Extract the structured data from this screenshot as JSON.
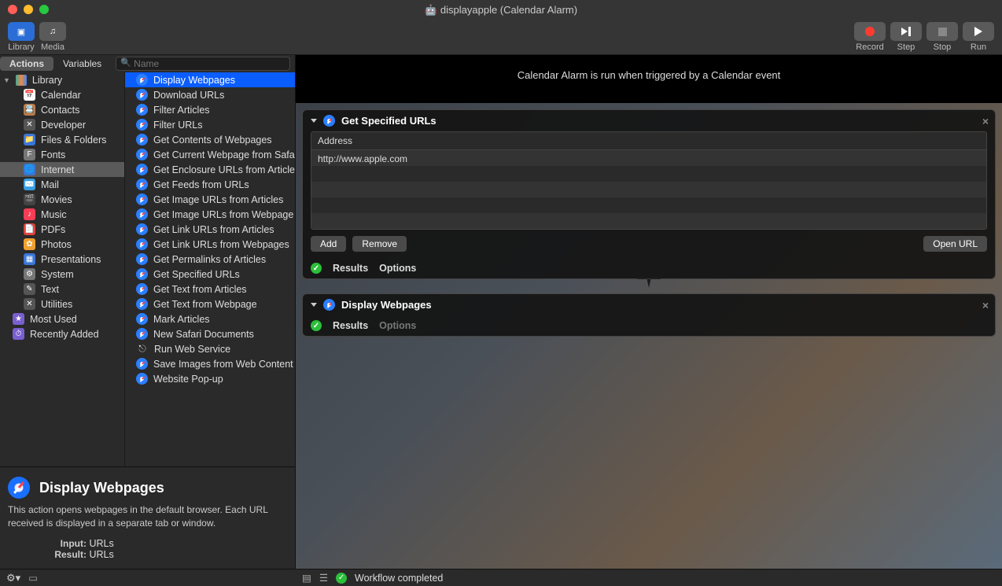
{
  "window": {
    "title": "displayapple (Calendar Alarm)"
  },
  "toolbar": {
    "library": "Library",
    "media": "Media",
    "record": "Record",
    "step": "Step",
    "stop": "Stop",
    "run": "Run"
  },
  "tabs": {
    "actions": "Actions",
    "variables": "Variables"
  },
  "search": {
    "placeholder": "Name"
  },
  "library": {
    "header": "Library",
    "items": [
      {
        "label": "Calendar",
        "icon": "📅",
        "bg": "#fff"
      },
      {
        "label": "Contacts",
        "icon": "📇",
        "bg": "#b97d4b"
      },
      {
        "label": "Developer",
        "icon": "✕",
        "bg": "#555"
      },
      {
        "label": "Files & Folders",
        "icon": "📁",
        "bg": "#3a76d8"
      },
      {
        "label": "Fonts",
        "icon": "F",
        "bg": "#777"
      },
      {
        "label": "Internet",
        "icon": "🌐",
        "bg": "#3a76d8",
        "selected": true
      },
      {
        "label": "Mail",
        "icon": "✉️",
        "bg": "#3a9de0"
      },
      {
        "label": "Movies",
        "icon": "🎬",
        "bg": "#444"
      },
      {
        "label": "Music",
        "icon": "♪",
        "bg": "#fa3c55"
      },
      {
        "label": "PDFs",
        "icon": "📄",
        "bg": "#e0443a"
      },
      {
        "label": "Photos",
        "icon": "✿",
        "bg": "#f0a030"
      },
      {
        "label": "Presentations",
        "icon": "▦",
        "bg": "#3a76d8"
      },
      {
        "label": "System",
        "icon": "⚙",
        "bg": "#777"
      },
      {
        "label": "Text",
        "icon": "✎",
        "bg": "#555"
      },
      {
        "label": "Utilities",
        "icon": "✕",
        "bg": "#555"
      }
    ],
    "footer": [
      {
        "label": "Most Used",
        "icon": "★",
        "bg": "#7a5fd0"
      },
      {
        "label": "Recently Added",
        "icon": "⏱",
        "bg": "#7a5fd0"
      }
    ]
  },
  "actions": [
    {
      "label": "Display Webpages",
      "selected": true
    },
    {
      "label": "Download URLs"
    },
    {
      "label": "Filter Articles"
    },
    {
      "label": "Filter URLs"
    },
    {
      "label": "Get Contents of Webpages"
    },
    {
      "label": "Get Current Webpage from Safari"
    },
    {
      "label": "Get Enclosure URLs from Articles"
    },
    {
      "label": "Get Feeds from URLs"
    },
    {
      "label": "Get Image URLs from Articles"
    },
    {
      "label": "Get Image URLs from Webpage"
    },
    {
      "label": "Get Link URLs from Articles"
    },
    {
      "label": "Get Link URLs from Webpages"
    },
    {
      "label": "Get Permalinks of Articles"
    },
    {
      "label": "Get Specified URLs"
    },
    {
      "label": "Get Text from Articles"
    },
    {
      "label": "Get Text from Webpage"
    },
    {
      "label": "Mark Articles"
    },
    {
      "label": "New Safari Documents"
    },
    {
      "label": "Run Web Service",
      "icon": "run"
    },
    {
      "label": "Save Images from Web Content"
    },
    {
      "label": "Website Pop-up"
    }
  ],
  "info": {
    "title": "Display Webpages",
    "desc": "This action opens webpages in the default browser. Each URL received is displayed in a separate tab or window.",
    "input_label": "Input:",
    "input_val": "URLs",
    "result_label": "Result:",
    "result_val": "URLs"
  },
  "canvas": {
    "header": "Calendar Alarm is run when triggered by a Calendar event"
  },
  "card1": {
    "title": "Get Specified URLs",
    "col": "Address",
    "rows": [
      "http://www.apple.com",
      "",
      "",
      "",
      ""
    ],
    "add": "Add",
    "remove": "Remove",
    "open": "Open URL",
    "results": "Results",
    "options": "Options"
  },
  "card2": {
    "title": "Display Webpages",
    "results": "Results",
    "options": "Options"
  },
  "status": {
    "msg": "Workflow completed"
  }
}
